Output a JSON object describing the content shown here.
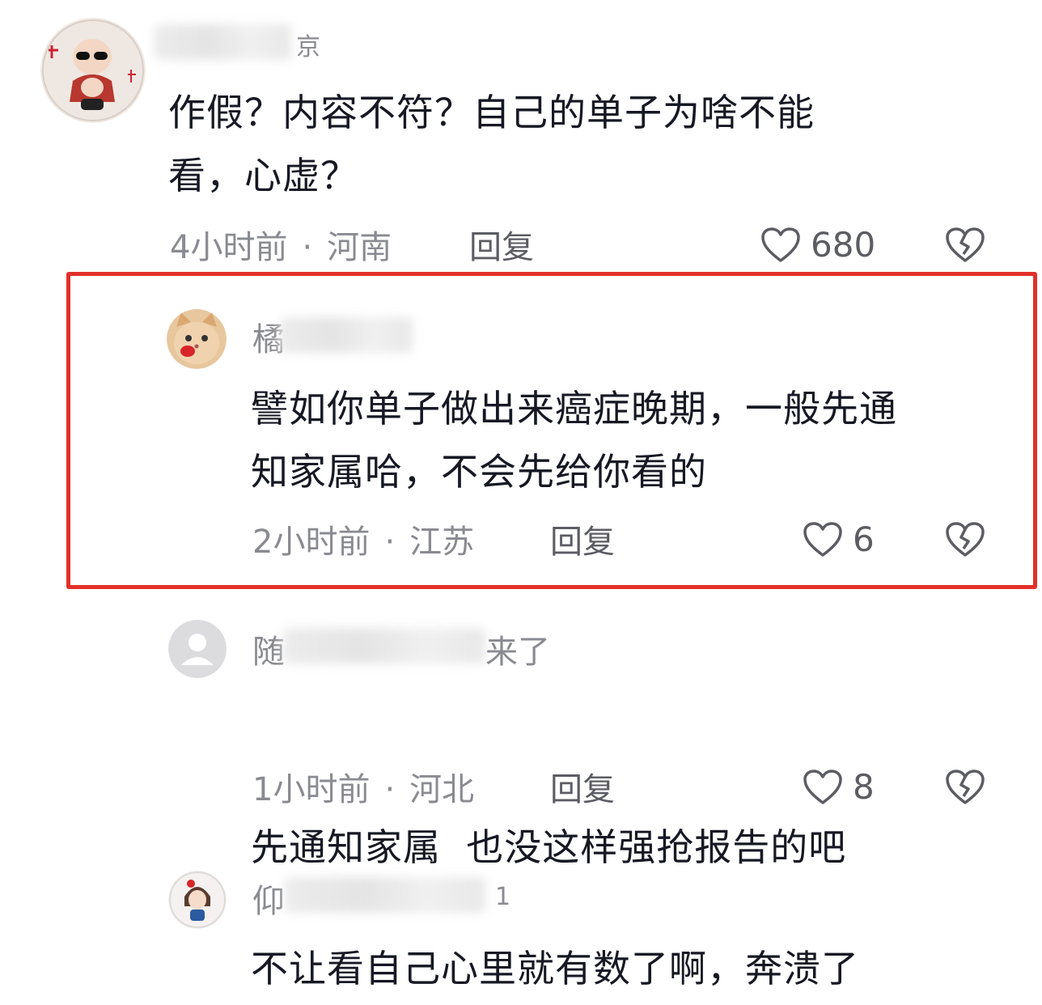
{
  "comments": [
    {
      "username": "",
      "username_tail": "京",
      "text_line1": "作假？内容不符？自己的单子为啥不能",
      "text_line2": "看，心虚？",
      "time": "4小时前",
      "location": "河南",
      "reply_label": "回复",
      "likes": "680",
      "highlighted": false
    },
    {
      "username": "橘",
      "username_tail": "",
      "text_line1": "譬如你单子做出来癌症晚期，一般先通",
      "text_line2": "知家属哈，不会先给你看的",
      "time": "2小时前",
      "location": "江苏",
      "reply_label": "回复",
      "likes": "6",
      "highlighted": true
    },
    {
      "username": "随",
      "username_tail": "来了",
      "text_line1": "先通知家属  也没这样强抢报告的吧",
      "text_line2": "",
      "time": "1小时前",
      "location": "河北",
      "reply_label": "回复",
      "likes": "8",
      "highlighted": false
    },
    {
      "username": "仰",
      "username_tail": "1",
      "text_line1": "不让看自己心里就有数了啊，奔溃了",
      "text_line2": "",
      "time": "",
      "location": "",
      "reply_label": "",
      "likes": "",
      "highlighted": false
    }
  ],
  "separator": "·",
  "icons": {
    "like": "heart-outline-icon",
    "dislike": "broken-heart-icon"
  },
  "colors": {
    "highlight_border": "#e3302a",
    "meta_text": "#8a8b91",
    "body_text": "#161823"
  }
}
